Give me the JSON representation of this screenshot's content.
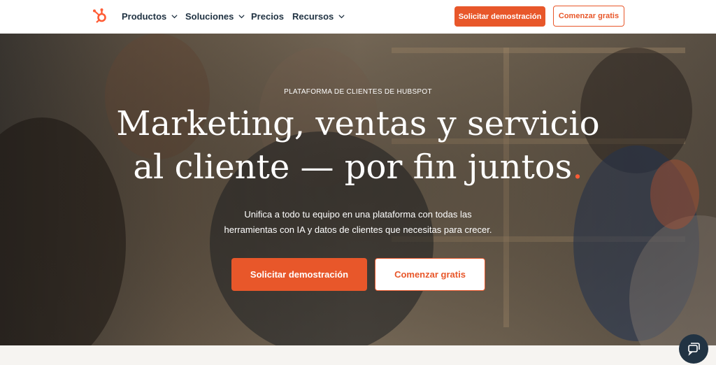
{
  "nav": {
    "logo_icon": "hubspot-sprocket-icon",
    "items": [
      {
        "label": "Productos",
        "has_dropdown": true
      },
      {
        "label": "Soluciones",
        "has_dropdown": true
      },
      {
        "label": "Precios",
        "has_dropdown": false
      },
      {
        "label": "Recursos",
        "has_dropdown": true
      }
    ],
    "demo_label": "Solicitar demostración",
    "free_label": "Comenzar gratis"
  },
  "hero": {
    "eyebrow": "PLATAFORMA DE CLIENTES DE HUBSPOT",
    "headline_line1": "Marketing, ventas y servicio",
    "headline_line2": "al cliente — por fin juntos",
    "headline_dot": ".",
    "subtitle_line1": "Unifica a todo tu equipo en una plataforma con todas las",
    "subtitle_line2": "herramientas con IA y datos de clientes que necesitas para crecer.",
    "demo_label": "Solicitar demostración",
    "free_label": "Comenzar gratis"
  },
  "chat": {
    "icon": "chat-bubble-icon"
  },
  "colors": {
    "accent": "#e8572a",
    "dark": "#213343",
    "dot": "#ff5c35"
  }
}
